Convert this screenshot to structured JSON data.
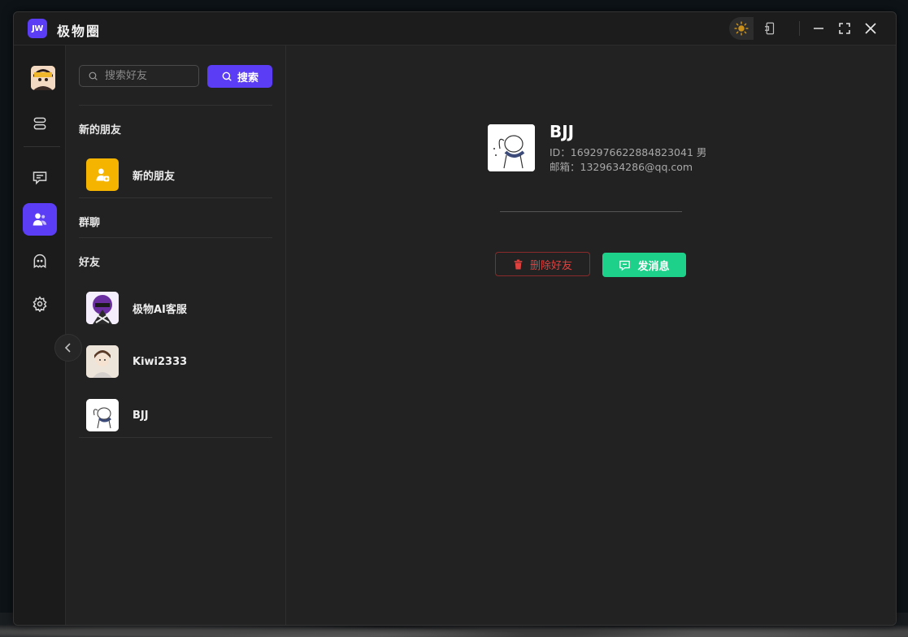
{
  "app": {
    "logo_text": "JW",
    "title": "极物圈"
  },
  "search": {
    "placeholder": "搜索好友",
    "value": "",
    "button_label": "搜索"
  },
  "sections": {
    "new_friends_header": "新的朋友",
    "groups_header": "群聊",
    "friends_header": "好友"
  },
  "new_friends_item": {
    "label": "新的朋友",
    "color": "#f5b400"
  },
  "friends": [
    {
      "name": "极物AI客服"
    },
    {
      "name": "Kiwi2333"
    },
    {
      "name": "BJJ"
    }
  ],
  "detail": {
    "name": "BJJ",
    "id_line": "ID：1692976622884823041 男",
    "email_line": "邮箱：1329634286@qq.com",
    "delete_label": "删除好友",
    "message_label": "发消息"
  },
  "colors": {
    "accent": "#5b3df5",
    "success": "#1ed18a",
    "danger": "#e0413f"
  },
  "rail_active": "contacts"
}
